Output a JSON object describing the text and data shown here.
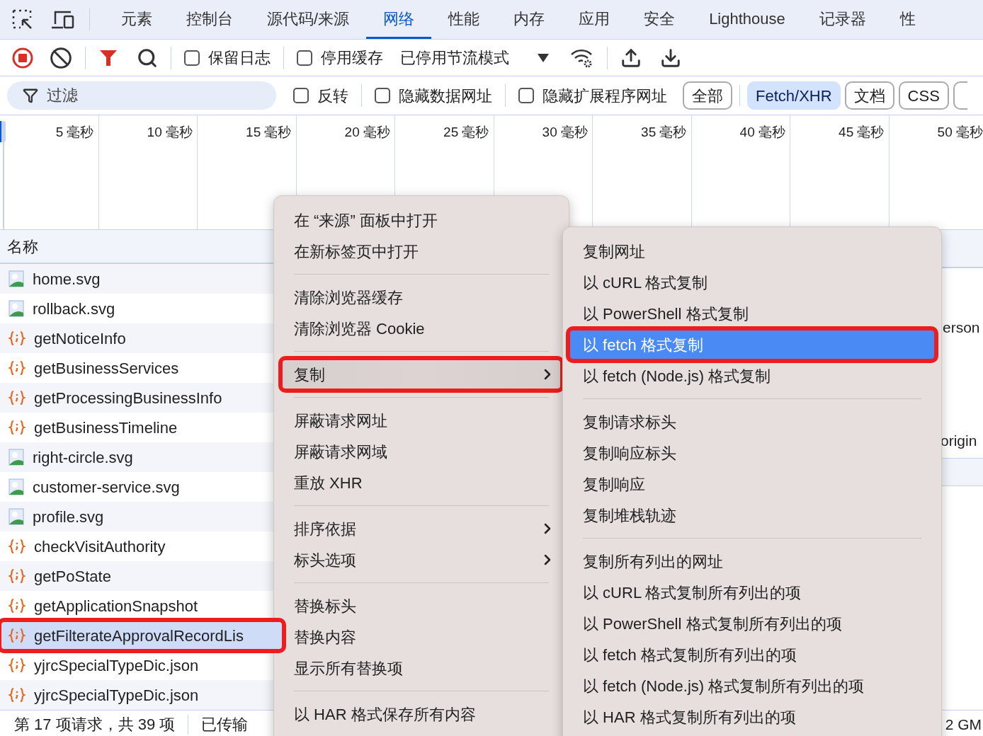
{
  "tabs": [
    {
      "label": "元素",
      "selected": false
    },
    {
      "label": "控制台",
      "selected": false
    },
    {
      "label": "源代码/来源",
      "selected": false
    },
    {
      "label": "网络",
      "selected": true
    },
    {
      "label": "性能",
      "selected": false
    },
    {
      "label": "内存",
      "selected": false
    },
    {
      "label": "应用",
      "selected": false
    },
    {
      "label": "安全",
      "selected": false
    },
    {
      "label": "Lighthouse",
      "selected": false
    },
    {
      "label": "记录器",
      "selected": false
    },
    {
      "label": "性",
      "selected": false
    }
  ],
  "toolbar": {
    "recording": true,
    "checkboxes": [
      {
        "label": "保留日志",
        "checked": false
      },
      {
        "label": "停用缓存",
        "checked": false
      }
    ],
    "throttling": "已停用节流模式"
  },
  "filter_bar": {
    "placeholder": "过滤",
    "checkboxes": [
      {
        "label": "反转",
        "checked": false
      },
      {
        "label": "隐藏数据网址",
        "checked": false
      },
      {
        "label": "隐藏扩展程序网址",
        "checked": false
      }
    ],
    "type_buttons": [
      {
        "label": "全部",
        "selected": false
      },
      {
        "label": "Fetch/XHR",
        "selected": true
      },
      {
        "label": "文档",
        "selected": false
      },
      {
        "label": "CSS",
        "selected": false
      }
    ]
  },
  "timeline": {
    "ticks": [
      "5 毫秒",
      "10 毫秒",
      "15 毫秒",
      "20 毫秒",
      "25 毫秒",
      "30 毫秒",
      "35 毫秒",
      "40 毫秒",
      "45 毫秒",
      "50 毫秒"
    ]
  },
  "table": {
    "column_1": "名称",
    "rows": [
      {
        "name": "home.svg",
        "kind": "image",
        "selected": false,
        "annotated": false
      },
      {
        "name": "rollback.svg",
        "kind": "image",
        "selected": false,
        "annotated": false
      },
      {
        "name": "getNoticeInfo",
        "kind": "fetch",
        "selected": false,
        "annotated": false
      },
      {
        "name": "getBusinessServices",
        "kind": "fetch",
        "selected": false,
        "annotated": false
      },
      {
        "name": "getProcessingBusinessInfo",
        "kind": "fetch",
        "selected": false,
        "annotated": false
      },
      {
        "name": "getBusinessTimeline",
        "kind": "fetch",
        "selected": false,
        "annotated": false
      },
      {
        "name": "right-circle.svg",
        "kind": "image",
        "selected": false,
        "annotated": false
      },
      {
        "name": "customer-service.svg",
        "kind": "image",
        "selected": false,
        "annotated": false
      },
      {
        "name": "profile.svg",
        "kind": "image",
        "selected": false,
        "annotated": false
      },
      {
        "name": "checkVisitAuthority",
        "kind": "fetch",
        "selected": false,
        "annotated": false
      },
      {
        "name": "getPoState",
        "kind": "fetch",
        "selected": false,
        "annotated": false
      },
      {
        "name": "getApplicationSnapshot",
        "kind": "fetch",
        "selected": false,
        "annotated": false
      },
      {
        "name": "getFilterateApprovalRecordLis",
        "kind": "fetch",
        "selected": true,
        "annotated": true
      },
      {
        "name": "yjrcSpecialTypeDic.json",
        "kind": "fetch",
        "selected": false,
        "annotated": false
      },
      {
        "name": "yjrcSpecialTypeDic.json",
        "kind": "fetch",
        "selected": false,
        "annotated": false
      }
    ]
  },
  "detail_pane": {
    "lines": [
      "erson",
      "origin"
    ]
  },
  "status_bar": {
    "items": [
      "第 17 项请求，共 39 项",
      "已传输"
    ],
    "trailing": "2 GM"
  },
  "context_menu": {
    "groups": [
      [
        {
          "label": "在 “来源” 面板中打开",
          "submenu": false,
          "highlighted": false,
          "annotated": false
        },
        {
          "label": "在新标签页中打开",
          "submenu": false,
          "highlighted": false,
          "annotated": false
        }
      ],
      [
        {
          "label": "清除浏览器缓存",
          "submenu": false,
          "highlighted": false,
          "annotated": false
        },
        {
          "label": "清除浏览器 Cookie",
          "submenu": false,
          "highlighted": false,
          "annotated": false
        }
      ],
      [
        {
          "label": "复制",
          "submenu": true,
          "highlighted": true,
          "annotated": true
        }
      ],
      [
        {
          "label": "屏蔽请求网址",
          "submenu": false,
          "highlighted": false,
          "annotated": false
        },
        {
          "label": "屏蔽请求网域",
          "submenu": false,
          "highlighted": false,
          "annotated": false
        },
        {
          "label": "重放 XHR",
          "submenu": false,
          "highlighted": false,
          "annotated": false
        }
      ],
      [
        {
          "label": "排序依据",
          "submenu": true,
          "highlighted": false,
          "annotated": false
        },
        {
          "label": "标头选项",
          "submenu": true,
          "highlighted": false,
          "annotated": false
        }
      ],
      [
        {
          "label": "替换标头",
          "submenu": false,
          "highlighted": false,
          "annotated": false
        },
        {
          "label": "替换内容",
          "submenu": false,
          "highlighted": false,
          "annotated": false
        },
        {
          "label": "显示所有替换项",
          "submenu": false,
          "highlighted": false,
          "annotated": false
        }
      ],
      [
        {
          "label": "以 HAR 格式保存所有内容",
          "submenu": false,
          "highlighted": false,
          "annotated": false
        }
      ]
    ]
  },
  "copy_submenu": {
    "groups": [
      [
        {
          "label": "复制网址",
          "selected": false,
          "annotated": false
        },
        {
          "label": "以 cURL 格式复制",
          "selected": false,
          "annotated": false
        },
        {
          "label": "以 PowerShell 格式复制",
          "selected": false,
          "annotated": false
        },
        {
          "label": "以 fetch 格式复制",
          "selected": true,
          "annotated": true
        },
        {
          "label": "以 fetch (Node.js) 格式复制",
          "selected": false,
          "annotated": false
        }
      ],
      [
        {
          "label": "复制请求标头",
          "selected": false,
          "annotated": false
        },
        {
          "label": "复制响应标头",
          "selected": false,
          "annotated": false
        },
        {
          "label": "复制响应",
          "selected": false,
          "annotated": false
        },
        {
          "label": "复制堆栈轨迹",
          "selected": false,
          "annotated": false
        }
      ],
      [
        {
          "label": "复制所有列出的网址",
          "selected": false,
          "annotated": false
        },
        {
          "label": "以 cURL 格式复制所有列出的项",
          "selected": false,
          "annotated": false
        },
        {
          "label": "以 PowerShell 格式复制所有列出的项",
          "selected": false,
          "annotated": false
        },
        {
          "label": "以 fetch 格式复制所有列出的项",
          "selected": false,
          "annotated": false
        },
        {
          "label": "以 fetch (Node.js) 格式复制所有列出的项",
          "selected": false,
          "annotated": false
        },
        {
          "label": "以 HAR 格式复制所有列出的项",
          "selected": false,
          "annotated": false
        }
      ]
    ]
  }
}
